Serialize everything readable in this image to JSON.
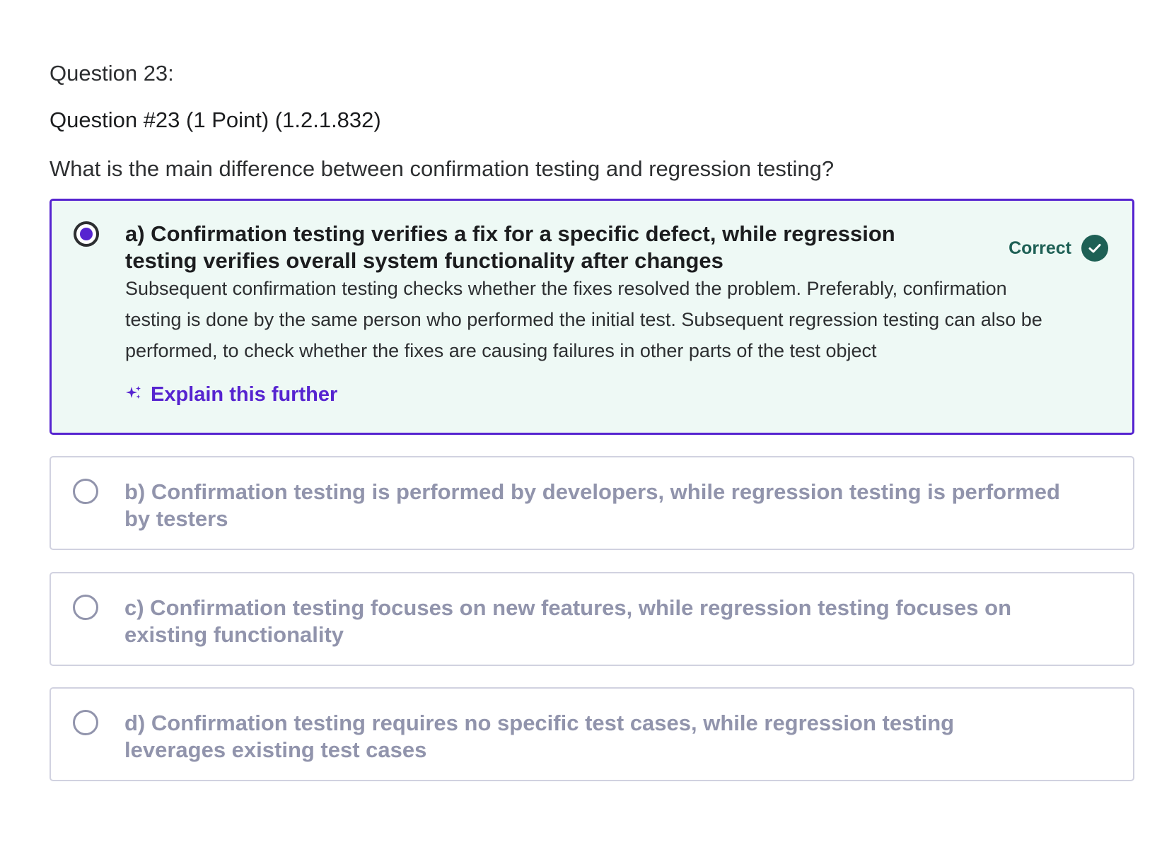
{
  "question": {
    "header": "Question 23:",
    "meta": "Question #23 (1 Point) (1.2.1.832)",
    "prompt": "What is the main difference between confirmation testing and regression testing?"
  },
  "options": [
    {
      "label": "a) Confirmation testing verifies a fix for a specific defect, while regression testing verifies overall system functionality after changes",
      "selected": true,
      "status": "Correct",
      "explanation": "Subsequent confirmation testing checks whether the fixes resolved the problem. Preferably, confirmation testing is done by the same person who performed the initial test. Subsequent regression testing can also be performed, to check whether the fixes are causing failures in other parts of the test object",
      "action_label": "Explain this further"
    },
    {
      "label": "b) Confirmation testing is performed by developers, while regression testing is performed by testers",
      "selected": false
    },
    {
      "label": "c) Confirmation testing focuses on new features, while regression testing focuses on existing functionality",
      "selected": false
    },
    {
      "label": "d) Confirmation testing requires no specific test cases, while regression testing leverages existing test cases",
      "selected": false
    }
  ],
  "icons": {
    "status": "check-circle-icon",
    "action": "sparkle-icon"
  },
  "colors": {
    "accent_purple": "#5624d0",
    "correct_green": "#1e6055",
    "selected_bg": "#eef9f5",
    "muted_text": "#9194ac",
    "border": "#d1d2e0"
  }
}
